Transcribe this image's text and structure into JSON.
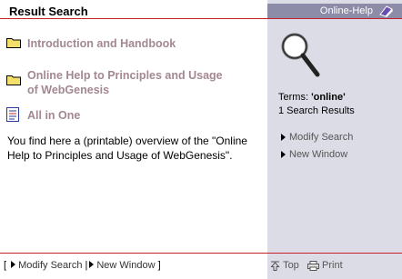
{
  "header": {
    "title": "Result Search",
    "side_title": "Online-Help"
  },
  "results": {
    "items": [
      {
        "label": "Introduction and Handbook"
      },
      {
        "label_line1": "Online Help to Principles and Usage",
        "label_line2": "of WebGenesis"
      },
      {
        "label": "All in One"
      }
    ],
    "description": "You find here a (printable) overview of the \"Online Help to Principles and Usage of WebGenesis\"."
  },
  "side": {
    "terms_label": "Terms: ",
    "terms_value": "'online'",
    "results_count": "1 Search Results",
    "modify_search": "Modify Search",
    "new_window": "New Window"
  },
  "footer": {
    "open_bracket": "[",
    "modify_search": "Modify Search",
    "separator": "|",
    "new_window": "New Window",
    "close_bracket": "]",
    "top": "Top",
    "print": "Print"
  },
  "icons": {
    "folder": "folder-icon",
    "document": "document-icon",
    "magnifier": "magnifier-icon",
    "book": "help-book-icon",
    "arrow_up": "arrow-up-icon",
    "printer": "printer-icon"
  },
  "colors": {
    "accent_red": "#c7202c",
    "link_mauve": "#a38890",
    "sidebar_bg": "#dcdce6",
    "sidebar_header": "#8c8ca8"
  }
}
